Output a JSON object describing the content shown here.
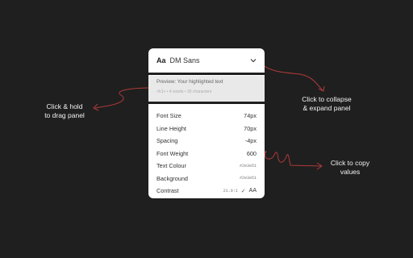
{
  "panel": {
    "header": {
      "aa": "Aa",
      "font_name": "DM Sans"
    },
    "preview": {
      "title": "Preview: Your highlighted text",
      "meta": "<h1> • 4 words • 30 characters"
    },
    "rows": [
      {
        "label": "Font Size",
        "value": "74px"
      },
      {
        "label": "Line Height",
        "value": "70px"
      },
      {
        "label": "Spacing",
        "value": "-4px"
      },
      {
        "label": "Font Weight",
        "value": "600"
      },
      {
        "label": "Text Colour",
        "value": "#2e3e51"
      },
      {
        "label": "Background",
        "value": "#2e3e51"
      },
      {
        "label": "Contrast",
        "ratio": "21.0:1",
        "check": "✓",
        "grade": "AA"
      }
    ]
  },
  "annotations": {
    "drag": "Click & hold\nto drag panel",
    "collapse": "Click to collapse\n& expand panel",
    "copy": "Click to copy\nvalues"
  },
  "colors": {
    "background": "#1f1f1f",
    "annotation": "#b03a3a"
  }
}
